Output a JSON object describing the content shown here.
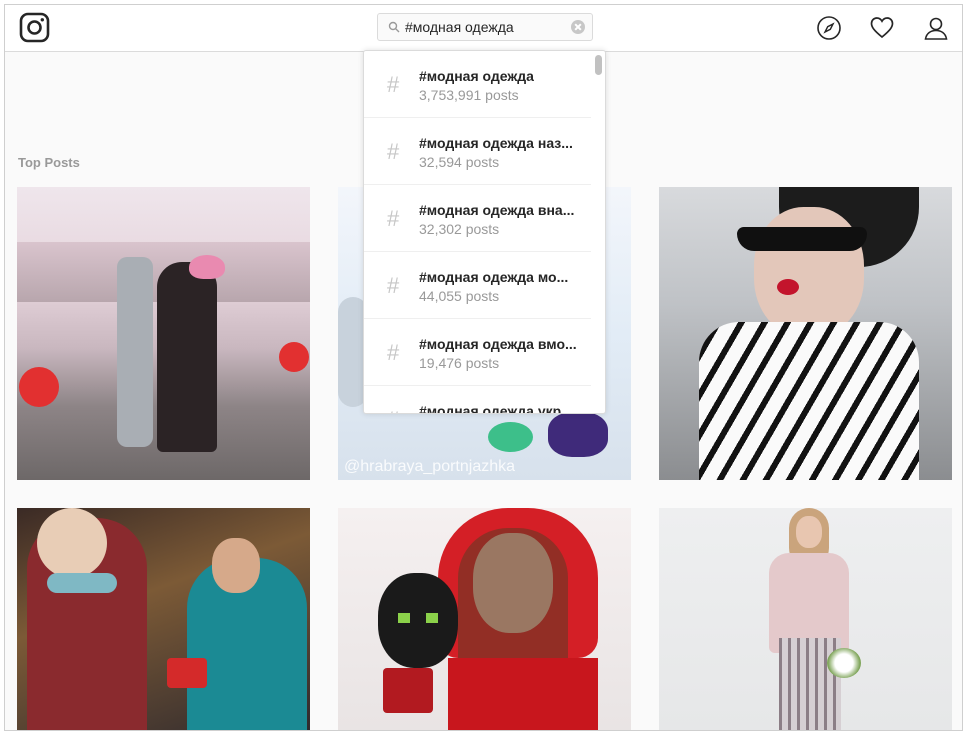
{
  "search": {
    "value": "#модная одежда"
  },
  "section": {
    "top_posts_label": "Top Posts"
  },
  "suggestions": [
    {
      "tag": "#модная одежда",
      "count": "3,753,991 posts"
    },
    {
      "tag": "#модная одежда наз...",
      "count": "32,594 posts"
    },
    {
      "tag": "#модная одежда вна...",
      "count": "32,302 posts"
    },
    {
      "tag": "#модная одежда мо...",
      "count": "44,055 posts"
    },
    {
      "tag": "#модная одежда вмо...",
      "count": "19,476 posts"
    },
    {
      "tag": "#модная одежда укр...",
      "count": ""
    }
  ],
  "posts": [
    {
      "watermark": ""
    },
    {
      "watermark": "@hrabraya_portnjazhka"
    },
    {
      "watermark": ""
    },
    {
      "watermark": ""
    },
    {
      "watermark": ""
    },
    {
      "watermark": ""
    }
  ],
  "icons": {
    "logo": "instagram-logo-icon",
    "search": "search-icon",
    "clear": "clear-icon",
    "explore": "compass-icon",
    "activity": "heart-icon",
    "profile": "user-icon",
    "hash": "hashtag-icon"
  },
  "colors": {
    "text": "#262626",
    "secondary_text": "#999999",
    "border": "#dbdbdb",
    "background": "#fafafa"
  }
}
